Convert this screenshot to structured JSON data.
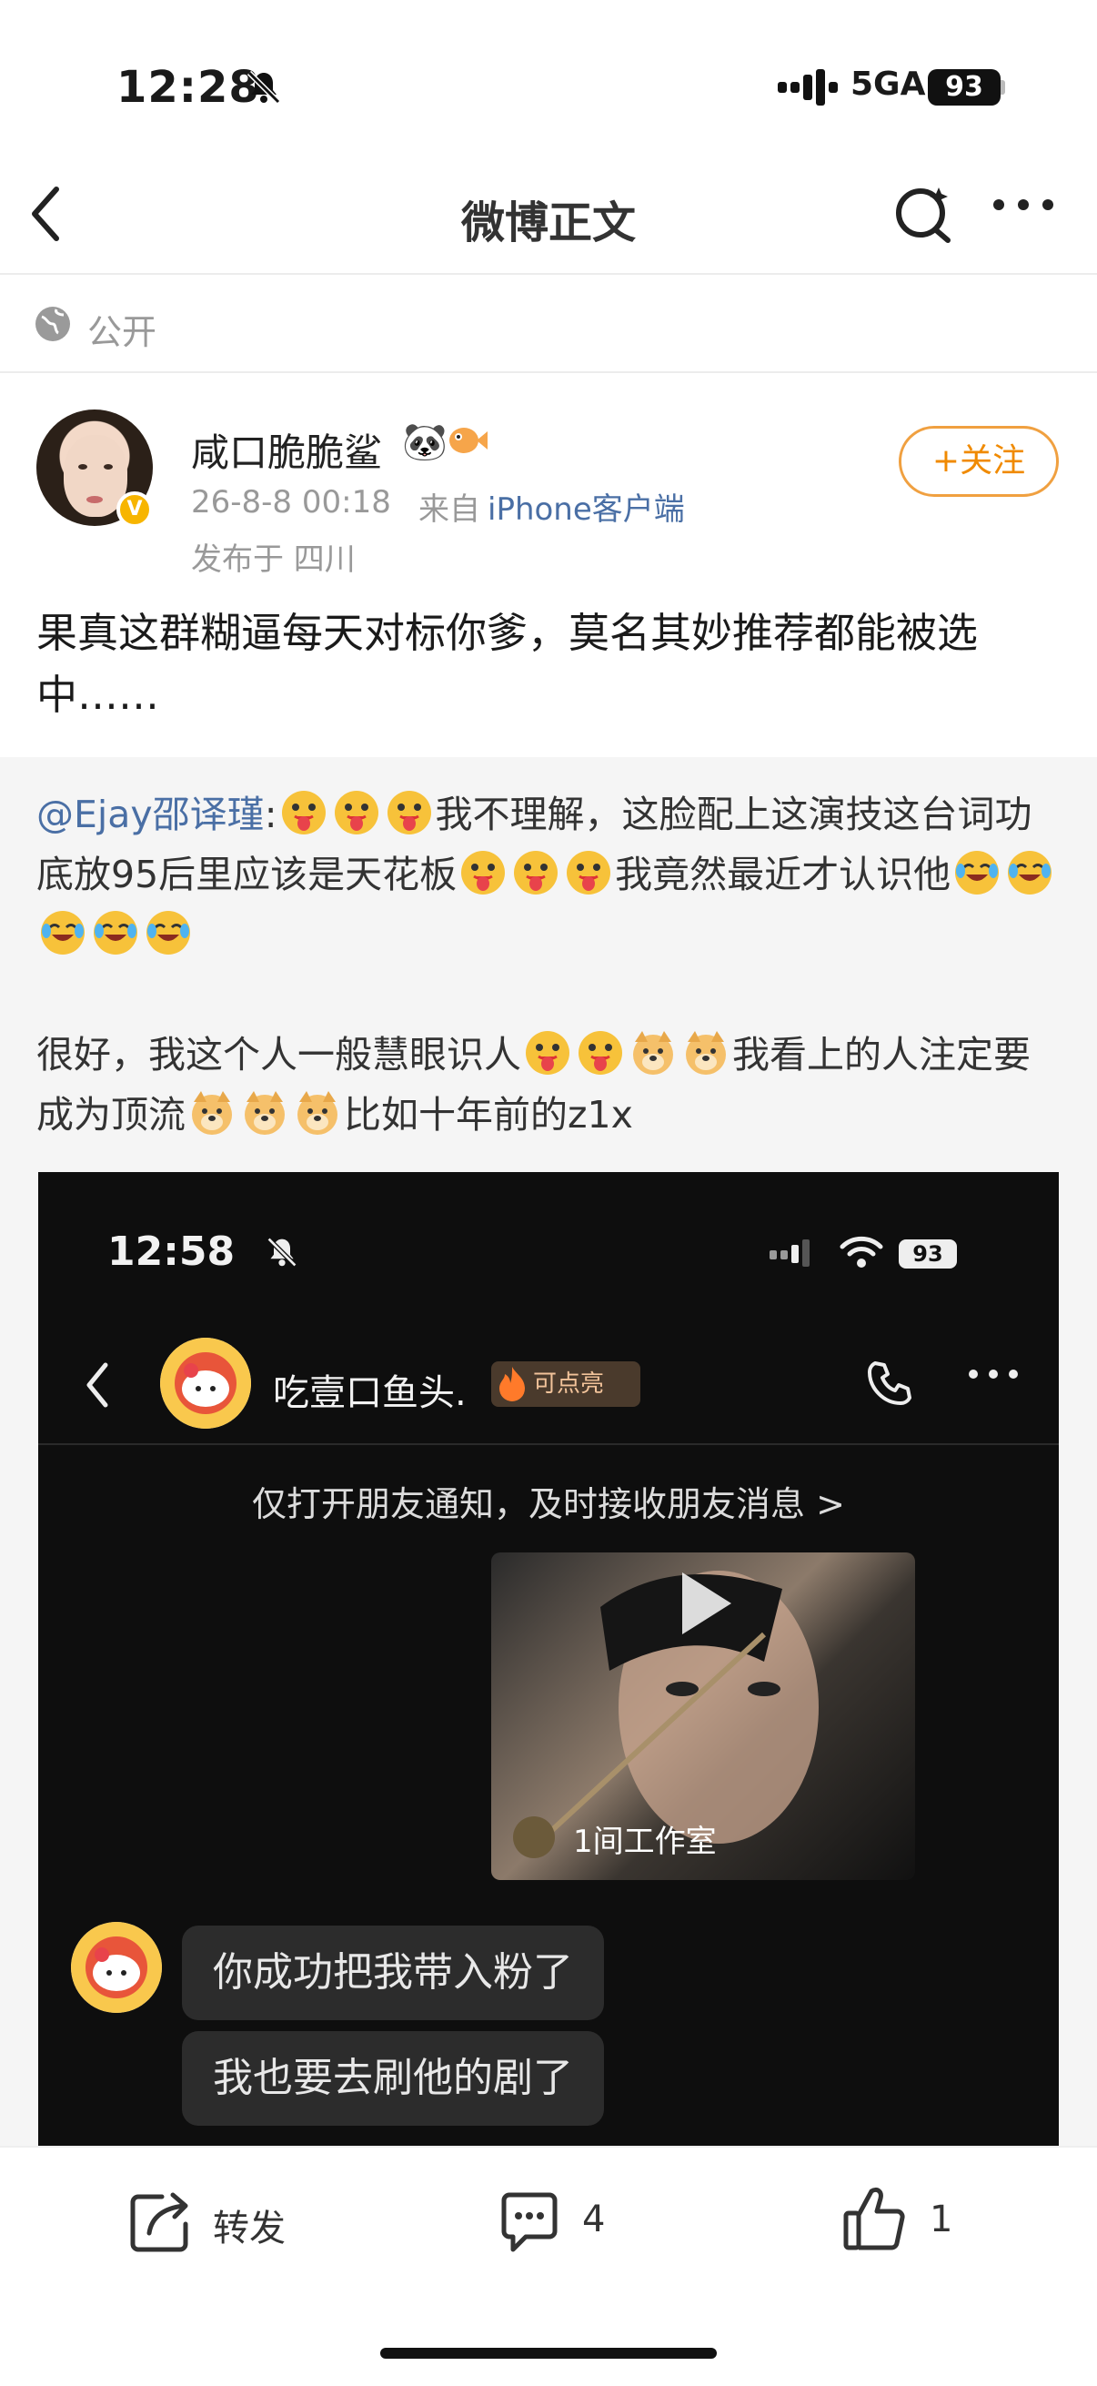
{
  "status_bar": {
    "time": "12:28",
    "network": "5GA",
    "battery": "93"
  },
  "nav": {
    "title": "微博正文"
  },
  "visibility": {
    "label": "公开"
  },
  "author": {
    "name": "咸口脆脆鲨",
    "date": "26-8-8 00:18",
    "source_prefix": "来自",
    "client": "iPhone客户端",
    "location": "发布于 四川",
    "follow_label": "+关注"
  },
  "post": {
    "text": "果真这群糊逼每天对标你爹，莫名其妙推荐都能被选中……"
  },
  "repost": {
    "mention": "@Ejay邵译瑾",
    "seg1": ":",
    "seg2": "我不理解，这脸配上这演技这台词功底放95后里应该是天花板",
    "seg3": "我竟然最近才认识他",
    "seg4": "很好，我这个人一般慧眼识人",
    "seg5": "我看上的人注定要成为顶流",
    "seg6": "比如十年前的z1x"
  },
  "screenshot": {
    "time": "12:58",
    "battery": "93",
    "chat_name": "吃壹口鱼头.",
    "fire_label": "可点亮",
    "notify": "仅打开朋友通知，及时接收朋友消息 >",
    "video_channel": "1间工作室",
    "messages": [
      "你成功把我带入粉了",
      "我也要去刷他的剧了"
    ]
  },
  "actions": {
    "repost_label": "转发",
    "comment_count": "4",
    "like_count": "1"
  }
}
